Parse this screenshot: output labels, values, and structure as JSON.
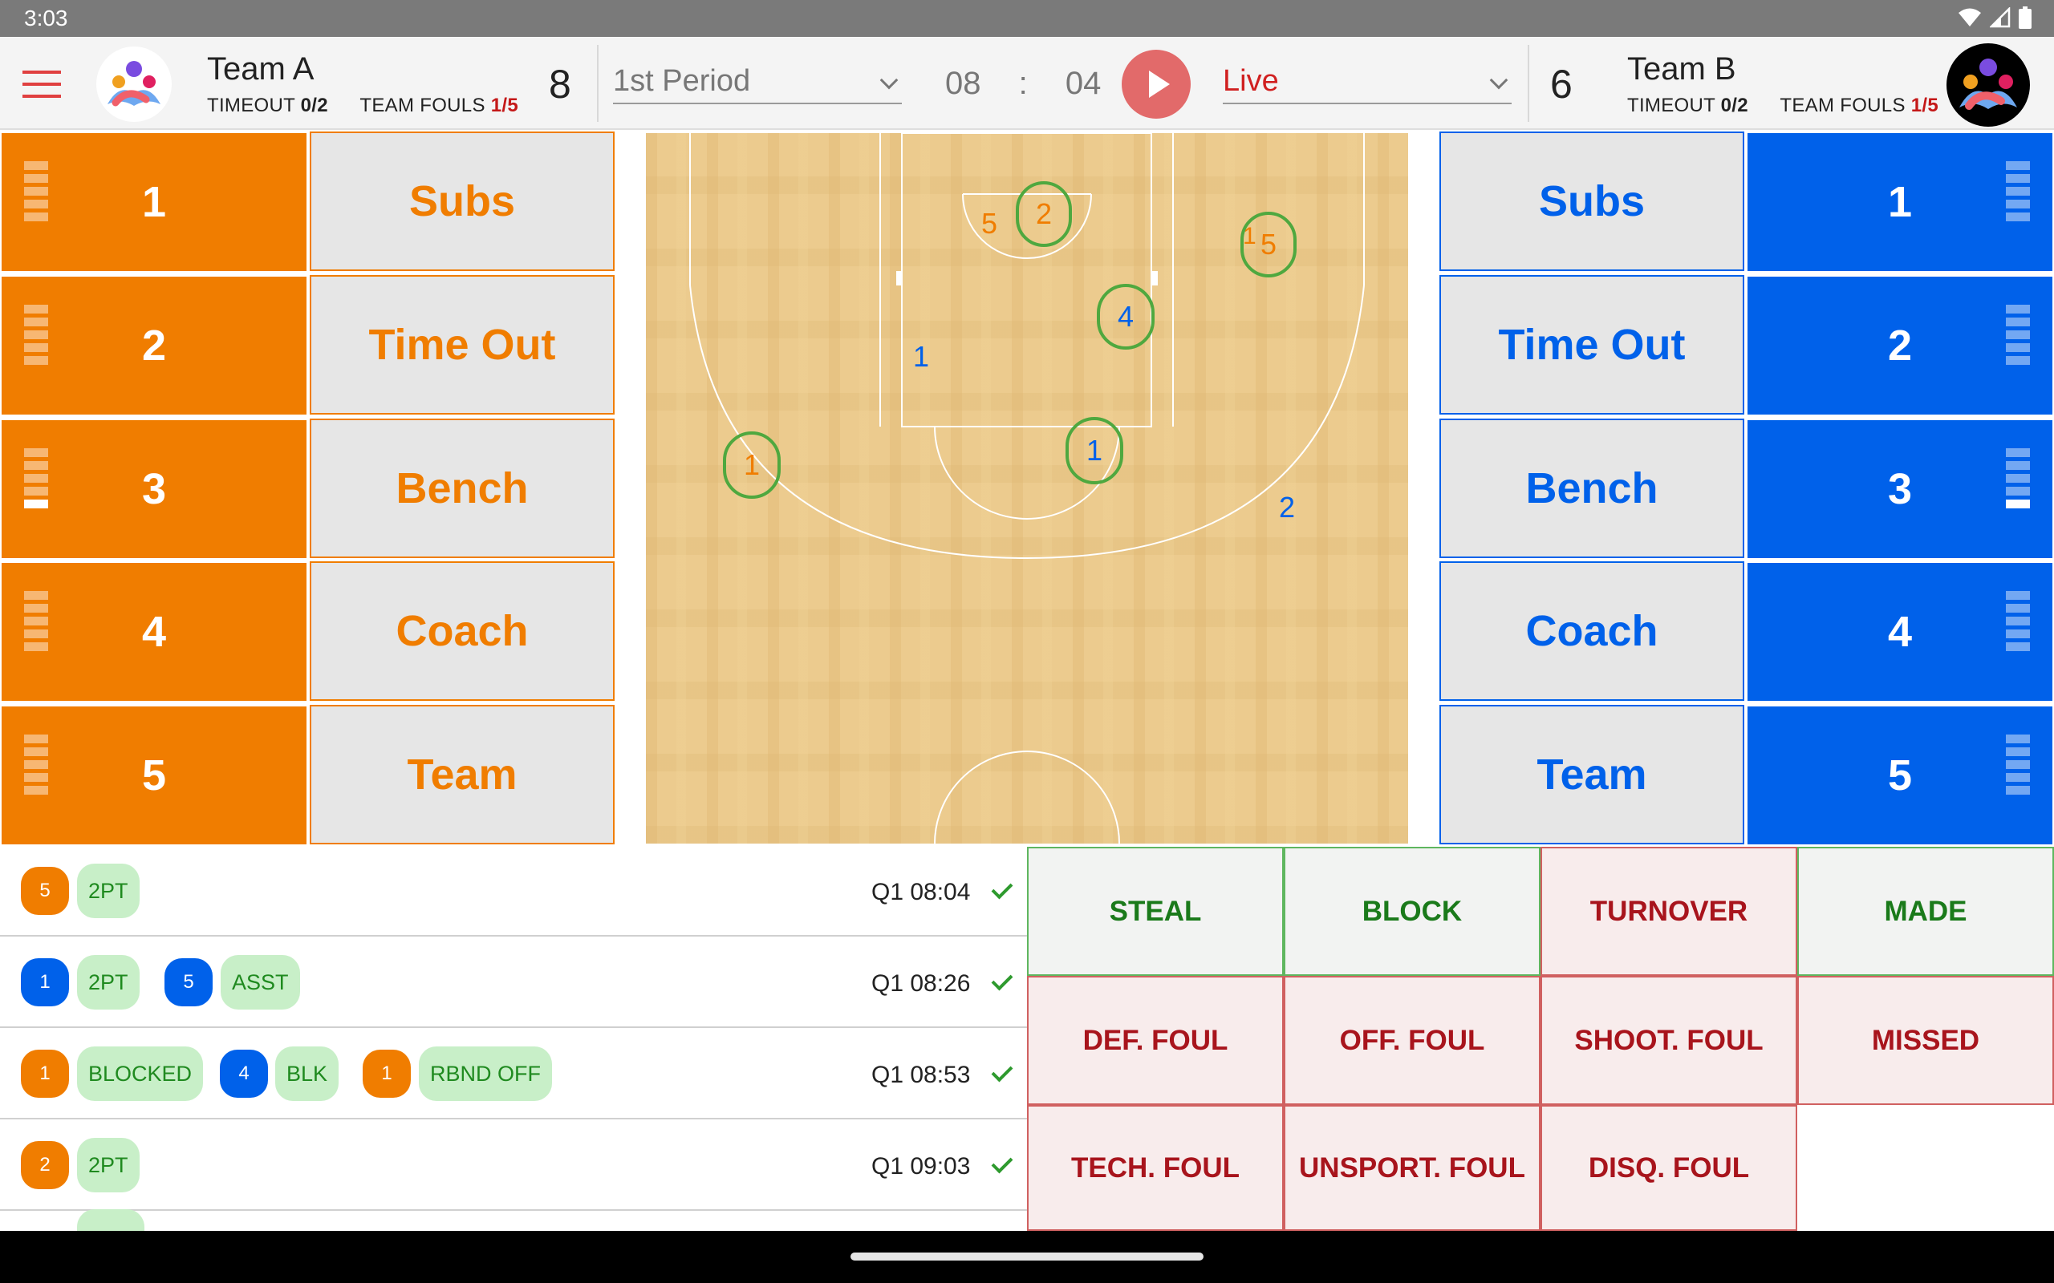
{
  "status_bar": {
    "time": "3:03"
  },
  "colors": {
    "team_a": "#f07d00",
    "team_b": "#0061ea",
    "success": "#2e9a2e",
    "danger": "#a8141c"
  },
  "team_a": {
    "name": "Team A",
    "timeout_label": "TIMEOUT",
    "timeout_value": "0/2",
    "fouls_label": "TEAM FOULS",
    "fouls_value": "1/5",
    "score": "8",
    "players": [
      {
        "number": "1",
        "fouls": 0
      },
      {
        "number": "2",
        "fouls": 0
      },
      {
        "number": "3",
        "fouls": 1
      },
      {
        "number": "4",
        "fouls": 0
      },
      {
        "number": "5",
        "fouls": 0
      }
    ],
    "actions": [
      "Subs",
      "Time Out",
      "Bench",
      "Coach",
      "Team"
    ]
  },
  "team_b": {
    "name": "Team B",
    "timeout_label": "TIMEOUT",
    "timeout_value": "0/2",
    "fouls_label": "TEAM FOULS",
    "fouls_value": "1/5",
    "score": "6",
    "players": [
      {
        "number": "1",
        "fouls": 0
      },
      {
        "number": "2",
        "fouls": 0
      },
      {
        "number": "3",
        "fouls": 1
      },
      {
        "number": "4",
        "fouls": 0
      },
      {
        "number": "5",
        "fouls": 0
      }
    ],
    "actions": [
      "Subs",
      "Time Out",
      "Bench",
      "Coach",
      "Team"
    ]
  },
  "game": {
    "period": "1st Period",
    "clock_minutes": "08",
    "clock_sep": ":",
    "clock_seconds": "04",
    "mode": "Live"
  },
  "court_markers": [
    {
      "label": "5",
      "team": "a"
    },
    {
      "label": "2",
      "team": "a"
    },
    {
      "label": "1",
      "team": "a"
    },
    {
      "label": "5",
      "team": "a"
    },
    {
      "label": "4",
      "team": "b"
    },
    {
      "label": "1",
      "team": "b"
    },
    {
      "label": "1",
      "team": "a"
    },
    {
      "label": "1",
      "team": "b"
    },
    {
      "label": "2",
      "team": "b"
    }
  ],
  "log": [
    {
      "time": "Q1 08:04",
      "items": [
        {
          "player": "5",
          "team": "a",
          "action": "2PT"
        }
      ]
    },
    {
      "time": "Q1 08:26",
      "items": [
        {
          "player": "1",
          "team": "b",
          "action": "2PT"
        },
        {
          "player": "5",
          "team": "b",
          "action": "ASST"
        }
      ]
    },
    {
      "time": "Q1 08:53",
      "items": [
        {
          "player": "1",
          "team": "a",
          "action": "BLOCKED"
        },
        {
          "player": "4",
          "team": "b",
          "action": "BLK"
        },
        {
          "player": "1",
          "team": "a",
          "action": "RBND OFF"
        }
      ]
    },
    {
      "time": "Q1 09:03",
      "items": [
        {
          "player": "2",
          "team": "a",
          "action": "2PT"
        }
      ]
    }
  ],
  "events": [
    {
      "label": "STEAL",
      "style": "green"
    },
    {
      "label": "BLOCK",
      "style": "green"
    },
    {
      "label": "TURNOVER",
      "style": "red"
    },
    {
      "label": "MADE",
      "style": "green"
    },
    {
      "label": "DEF. FOUL",
      "style": "red"
    },
    {
      "label": "OFF. FOUL",
      "style": "red"
    },
    {
      "label": "SHOOT. FOUL",
      "style": "red"
    },
    {
      "label": "MISSED",
      "style": "red"
    },
    {
      "label": "TECH. FOUL",
      "style": "red"
    },
    {
      "label": "UNSPORT. FOUL",
      "style": "red"
    },
    {
      "label": "DISQ. FOUL",
      "style": "red"
    }
  ]
}
